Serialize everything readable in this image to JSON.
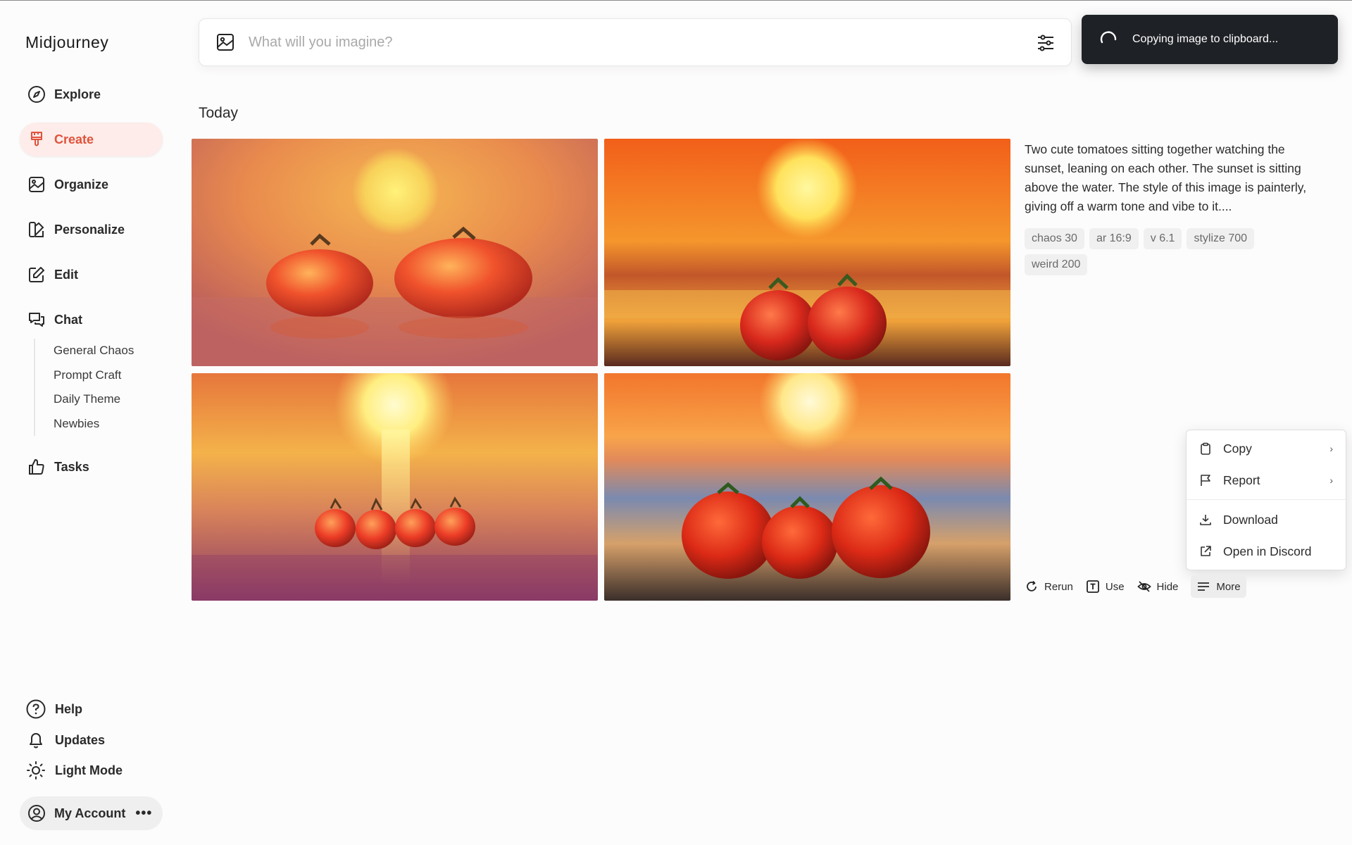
{
  "app": {
    "name": "Midjourney"
  },
  "nav": {
    "items": [
      {
        "label": "Explore",
        "icon": "compass-icon"
      },
      {
        "label": "Create",
        "icon": "brush-icon",
        "active": true
      },
      {
        "label": "Organize",
        "icon": "image-icon"
      },
      {
        "label": "Personalize",
        "icon": "palette-icon"
      },
      {
        "label": "Edit",
        "icon": "edit-icon"
      },
      {
        "label": "Chat",
        "icon": "chat-icon"
      }
    ],
    "chat_channels": [
      "General Chaos",
      "Prompt Craft",
      "Daily Theme",
      "Newbies"
    ],
    "tasks": "Tasks"
  },
  "bottom": {
    "help": "Help",
    "updates": "Updates",
    "light_mode": "Light Mode",
    "account": "My Account"
  },
  "search": {
    "placeholder": "What will you imagine?"
  },
  "toast": {
    "text": "Copying image to clipboard..."
  },
  "feed": {
    "section": "Today",
    "prompt": "Two cute tomatoes sitting together watching the sunset, leaning on each other. The sunset is sitting above the water. The style of this image is painterly, giving off a warm tone and vibe to it....",
    "tags": [
      "chaos 30",
      "ar 16:9",
      "v 6.1",
      "stylize 700",
      "weird 200"
    ],
    "actions": {
      "rerun": "Rerun",
      "use": "Use",
      "hide": "Hide",
      "more": "More"
    }
  },
  "menu": {
    "copy": "Copy",
    "report": "Report",
    "download": "Download",
    "open_discord": "Open in Discord"
  },
  "colors": {
    "accent": "#e0533c",
    "toast_bg": "#1e2125"
  }
}
